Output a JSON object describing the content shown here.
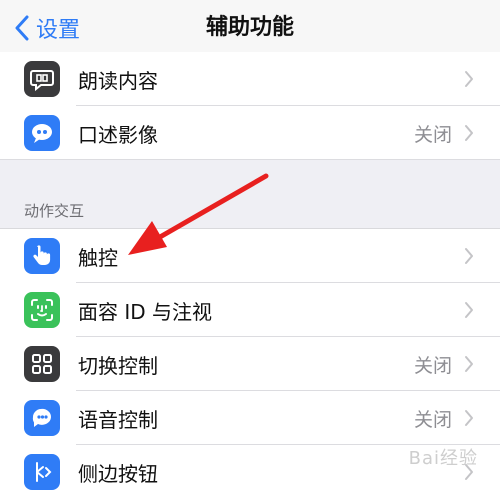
{
  "nav": {
    "back_label": "设置",
    "title": "辅助功能"
  },
  "group_top": [
    {
      "label": "朗读内容",
      "value": "",
      "icon": "speech-bubble-icon",
      "icon_color": "#3a3a3c"
    },
    {
      "label": "口述影像",
      "value": "关闭",
      "icon": "quote-bubble-icon",
      "icon_color": "#2f7cf6"
    }
  ],
  "section_header": "动作交互",
  "group_interaction": [
    {
      "label": "触控",
      "value": "",
      "icon": "hand-touch-icon",
      "icon_color": "#2f7cf6"
    },
    {
      "label": "面容 ID 与注视",
      "value": "",
      "icon": "face-id-icon",
      "icon_color": "#3ac25a"
    },
    {
      "label": "切换控制",
      "value": "关闭",
      "icon": "grid-icon",
      "icon_color": "#3a3a3c"
    },
    {
      "label": "语音控制",
      "value": "关闭",
      "icon": "voice-control-icon",
      "icon_color": "#2f7cf6"
    },
    {
      "label": "侧边按钮",
      "value": "",
      "icon": "side-button-icon",
      "icon_color": "#2f7cf6"
    }
  ],
  "annotation": {
    "color": "#e8201f"
  },
  "watermark": "Bai经验"
}
